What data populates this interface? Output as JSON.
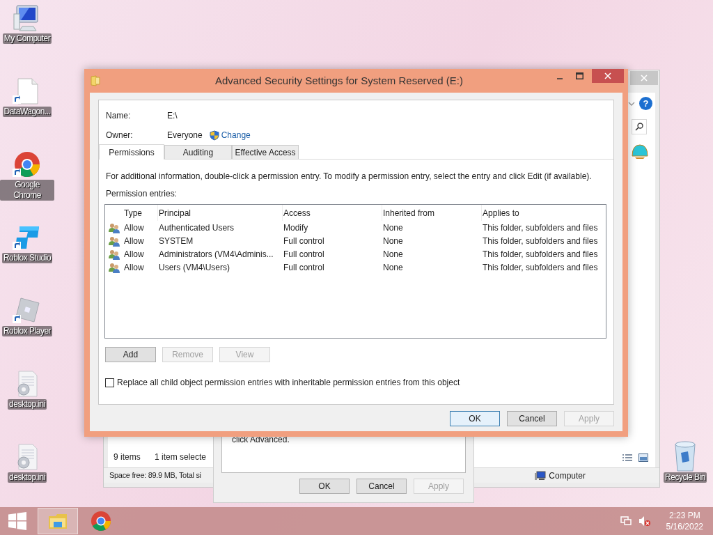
{
  "desktop_icons": [
    {
      "kind": "computer",
      "label": "My Computer"
    },
    {
      "kind": "file",
      "label": "DataWagon..."
    },
    {
      "kind": "chrome",
      "label": "Google Chrome"
    },
    {
      "kind": "studio",
      "label": "Roblox Studio"
    },
    {
      "kind": "player",
      "label": "Roblox Player"
    },
    {
      "kind": "ini",
      "label": "desktop.ini"
    },
    {
      "kind": "ini",
      "label": "desktop.ini"
    }
  ],
  "recycle_bin": {
    "label": "Recycle Bin"
  },
  "explorer_window": {
    "help_glyph": "?",
    "items_count": "9 items",
    "selection": "1 item selecte",
    "space": "Space free: 89.9 MB, Total si",
    "location": "Computer"
  },
  "properties_dialog": {
    "text": "click Advanced.",
    "buttons": [
      {
        "label": "OK",
        "disabled": false
      },
      {
        "label": "Cancel",
        "disabled": false
      },
      {
        "label": "Apply",
        "disabled": true
      }
    ]
  },
  "dialog": {
    "title": "Advanced Security Settings for System Reserved (E:)",
    "name_label": "Name:",
    "name_value": "E:\\",
    "owner_label": "Owner:",
    "owner_value": "Everyone",
    "change_link": "Change",
    "tabs": [
      {
        "label": "Permissions",
        "selected": true
      },
      {
        "label": "Auditing",
        "selected": false
      },
      {
        "label": "Effective Access",
        "selected": false
      }
    ],
    "info": "For additional information, double-click a permission entry. To modify a permission entry, select the entry and click Edit (if available).",
    "entries_label": "Permission entries:",
    "columns": [
      "Type",
      "Principal",
      "Access",
      "Inherited from",
      "Applies to"
    ],
    "rows": [
      [
        "Allow",
        "Authenticated Users",
        "Modify",
        "None",
        "This folder, subfolders and files"
      ],
      [
        "Allow",
        "SYSTEM",
        "Full control",
        "None",
        "This folder, subfolders and files"
      ],
      [
        "Allow",
        "Administrators (VM4\\Adminis...",
        "Full control",
        "None",
        "This folder, subfolders and files"
      ],
      [
        "Allow",
        "Users (VM4\\Users)",
        "Full control",
        "None",
        "This folder, subfolders and files"
      ]
    ],
    "entry_buttons": [
      {
        "label": "Add",
        "disabled": false
      },
      {
        "label": "Remove",
        "disabled": true
      },
      {
        "label": "View",
        "disabled": true
      }
    ],
    "replace_checkbox": {
      "label": "Replace all child object permission entries with inheritable permission entries from this object",
      "checked": false
    },
    "footer_buttons": [
      {
        "label": "OK",
        "disabled": false,
        "default": true
      },
      {
        "label": "Cancel",
        "disabled": false,
        "default": false
      },
      {
        "label": "Apply",
        "disabled": true,
        "default": false
      }
    ]
  },
  "taskbar": {
    "apps": [
      {
        "kind": "explorer",
        "selected": true
      },
      {
        "kind": "chrome",
        "selected": false
      }
    ],
    "time": "2:23 PM",
    "date": "5/16/2022"
  }
}
